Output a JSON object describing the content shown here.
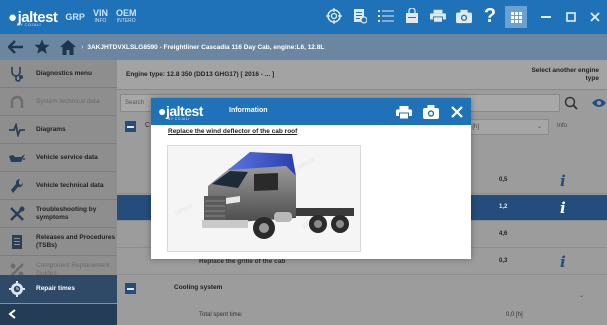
{
  "app": {
    "logo": "jaltest",
    "logo_sub": "BY COJALI",
    "nav": [
      {
        "label": "GRP",
        "sub": ""
      },
      {
        "label": "VIN",
        "sub": "INFO"
      },
      {
        "label": "OEM",
        "sub": "INTERO"
      }
    ],
    "help_glyph": "?",
    "top_icons": [
      "target-icon",
      "document-icon",
      "list-icon",
      "shopping-bag-icon",
      "printer-icon",
      "camera-icon",
      "help-icon",
      "apps-icon"
    ],
    "window_controls": [
      "minimize",
      "maximize",
      "close"
    ]
  },
  "breadcrumb": {
    "text": "3AKJHTDVXLSLG8590 - Freightliner Cascadia 116 Day Cab, engine:L6, 12.8L"
  },
  "sidebar": {
    "items": [
      {
        "label": "Diagnostics menu",
        "icon": "stethoscope-icon",
        "dim": false
      },
      {
        "label": "System technical data",
        "icon": "horseshoe-icon",
        "dim": true
      },
      {
        "label": "Diagrams",
        "icon": "diagram-icon",
        "dim": false
      },
      {
        "label": "Vehicle service data",
        "icon": "oil-can-icon",
        "dim": false
      },
      {
        "label": "Vehicle technical data",
        "icon": "wrench-icon",
        "dim": false
      },
      {
        "label": "Troubleshooting by symptoms",
        "icon": "tools-icon",
        "dim": false
      },
      {
        "label": "Releases and Procedures (TSBs)",
        "icon": "bulletin-icon",
        "dim": false
      },
      {
        "label": "Component Replacement Guides",
        "icon": "components-icon",
        "dim": true
      },
      {
        "label": "Repair times",
        "icon": "gear-clock-icon",
        "dim": false,
        "active": true
      }
    ],
    "back_icon": "back-icon"
  },
  "main": {
    "engine_type": "Engine type:  12.8 350 (DD13 GHG17) [ 2016 - ... ]",
    "select_another": "Select another engine type",
    "search_placeholder": "Search",
    "unit_select": "... - [h]",
    "info_header": "Info",
    "section_first_letter": "C",
    "rows": [
      {
        "text": "",
        "value": "0,5",
        "selected": false
      },
      {
        "text": "",
        "value": "1,2",
        "selected": true
      },
      {
        "text": "",
        "value": "4,6",
        "selected": false
      },
      {
        "text": "Replace the grille of the cab",
        "value": "0,3",
        "selected": false
      }
    ],
    "cooling_section": "Cooling system",
    "total_label": "Total spent time:",
    "total_value": "0,0 [h]"
  },
  "modal": {
    "logo": "jaltest",
    "logo_sub": "BY COJALI",
    "title": "Information",
    "caption": "Replace the wind deflector of the cab roof",
    "image_alt": "Freightliner Cascadia truck with roof wind deflector highlighted",
    "highlight_color": "#3a55c8"
  },
  "colors": {
    "brand_blue": "#1f72b8",
    "selected_row": "#244d7c",
    "overlay_gray": "#9a9a9a"
  }
}
